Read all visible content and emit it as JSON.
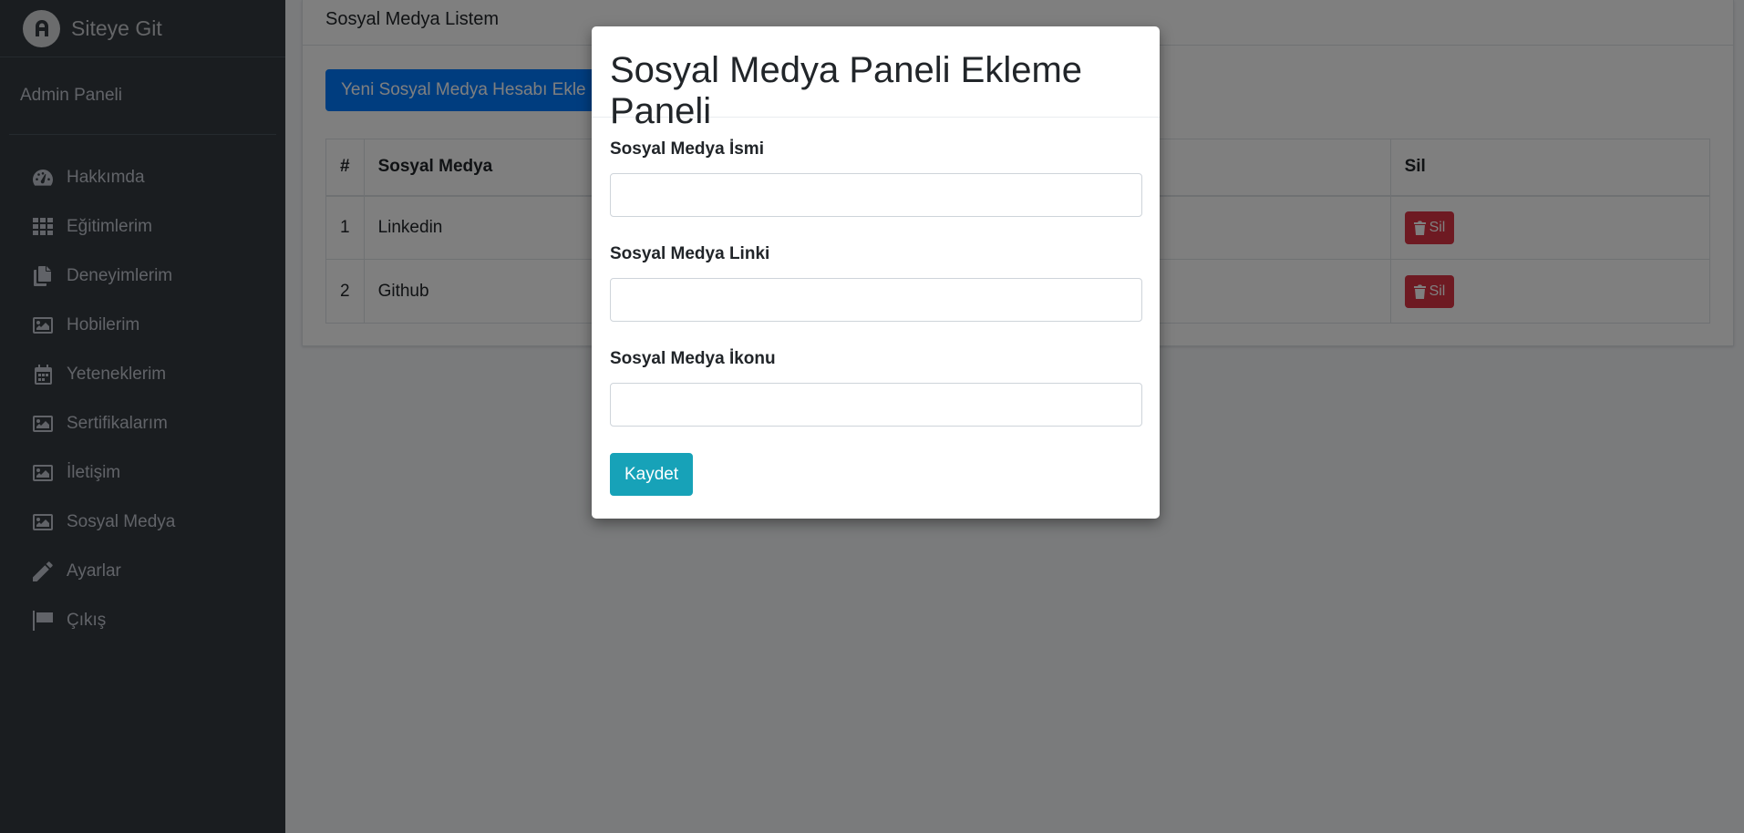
{
  "brand": {
    "text": "Siteye Git"
  },
  "user_panel": {
    "label": "Admin Paneli"
  },
  "sidebar": {
    "items": [
      {
        "label": "Hakkımda",
        "icon": "tachometer-icon"
      },
      {
        "label": "Eğitimlerim",
        "icon": "grid-icon"
      },
      {
        "label": "Deneyimlerim",
        "icon": "copy-icon"
      },
      {
        "label": "Hobilerim",
        "icon": "image-icon"
      },
      {
        "label": "Yeteneklerim",
        "icon": "calendar-icon"
      },
      {
        "label": "Sertifikalarım",
        "icon": "image-icon"
      },
      {
        "label": "İletişim",
        "icon": "image-icon"
      },
      {
        "label": "Sosyal Medya",
        "icon": "image-icon"
      },
      {
        "label": "Ayarlar",
        "icon": "pencil-icon"
      },
      {
        "label": "Çıkış",
        "icon": "flag-icon"
      }
    ]
  },
  "card": {
    "title": "Sosyal Medya Listem",
    "add_button": "Yeni Sosyal Medya Hesabı Ekle"
  },
  "table": {
    "headers": [
      "#",
      "Sosyal Medya",
      "Sil"
    ],
    "rows": [
      {
        "no": "1",
        "name": "Linkedin",
        "delete": "Sil"
      },
      {
        "no": "2",
        "name": "Github",
        "delete": "Sil"
      }
    ]
  },
  "modal": {
    "title": "Sosyal Medya Paneli Ekleme Paneli",
    "fields": [
      {
        "label": "Sosyal Medya İsmi",
        "value": ""
      },
      {
        "label": "Sosyal Medya Linki",
        "value": ""
      },
      {
        "label": "Sosyal Medya İkonu",
        "value": ""
      }
    ],
    "save_button": "Kaydet"
  },
  "colors": {
    "sidebar_bg": "#343a40",
    "primary": "#007bff",
    "danger": "#dc3545",
    "info": "#17a2b8"
  }
}
